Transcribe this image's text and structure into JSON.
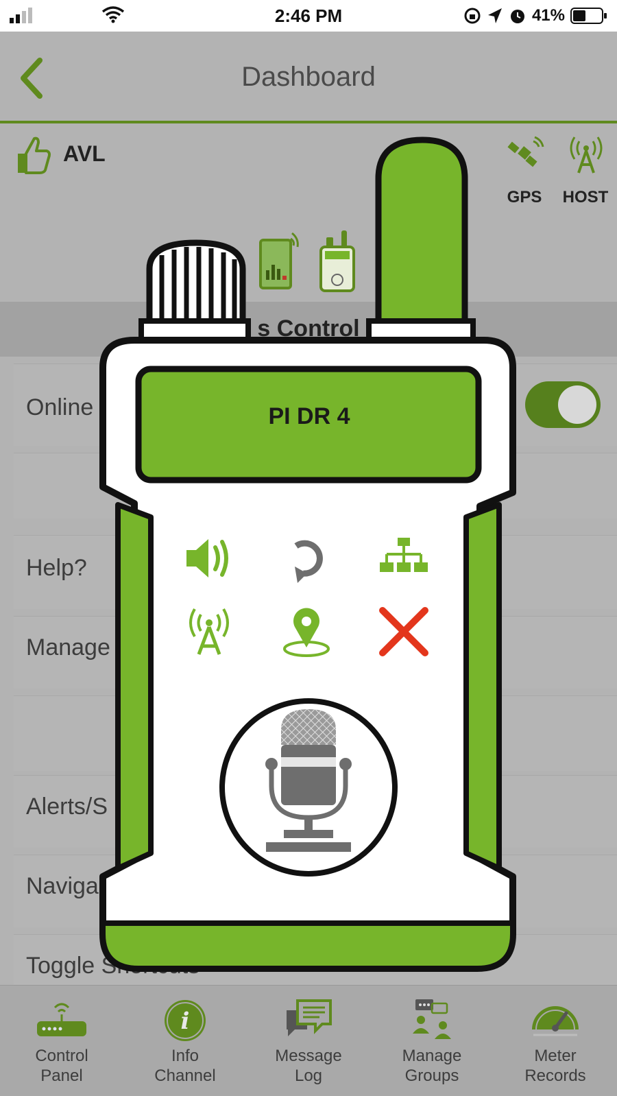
{
  "status_bar": {
    "time": "2:46 PM",
    "battery_percent": "41%",
    "icons": [
      "signal-icon",
      "wifi-icon",
      "lock-rotation-icon",
      "location-arrow-icon",
      "alarm-icon",
      "battery-icon"
    ]
  },
  "nav": {
    "title": "Dashboard",
    "back_icon": "chevron-left-icon"
  },
  "avl": {
    "label": "AVL",
    "thumb_icon": "thumbs-up-icon",
    "gps_label": "GPS",
    "host_label": "HOST"
  },
  "section": {
    "title": "s Control"
  },
  "list": {
    "online": "Online",
    "help": "Help?",
    "manage": "Manage",
    "alerts": "Alerts/S",
    "navigation": "Naviga",
    "toggle_shortcuts": "Toggle Shortcuts"
  },
  "toggle": {
    "online_on": true
  },
  "radio": {
    "display_text": "PI DR 4",
    "buttons": [
      "volume-icon",
      "refresh-icon",
      "network-icon",
      "tower-icon",
      "location-pin-icon",
      "close-x-icon"
    ],
    "mic_icon": "microphone-icon"
  },
  "tabs": [
    {
      "label": "Control\nPanel",
      "icon": "router-icon"
    },
    {
      "label": "Info\nChannel",
      "icon": "info-icon"
    },
    {
      "label": "Message\nLog",
      "icon": "chat-icon"
    },
    {
      "label": "Manage\nGroups",
      "icon": "groups-icon"
    },
    {
      "label": "Meter\nRecords",
      "icon": "gauge-icon"
    }
  ],
  "colors": {
    "accent_green": "#77b52b",
    "dim_green": "#5f8a1e",
    "red": "#e3361c",
    "gray_icon": "#6e6e6e"
  }
}
